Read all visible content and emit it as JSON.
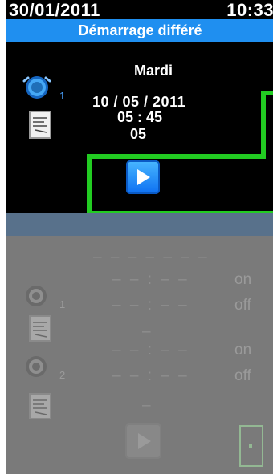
{
  "header": {
    "date": "30/01/2011",
    "time": "10:33",
    "title": "Démarrage différé"
  },
  "schedule": {
    "day": "Mardi",
    "date": "10 / 05 / 2011",
    "time": "05 : 45",
    "extra": "05",
    "alarm_label": "1"
  },
  "lower": {
    "placeholder_top": "– – – – – – –",
    "row1": {
      "label": "1",
      "time1": "– – : – –",
      "time2": "– – : – –",
      "state1": "on",
      "state2": "off"
    },
    "mid_dash": "–",
    "row2": {
      "label": "2",
      "time1": "– – : – –",
      "time2": "– – : – –",
      "state1": "on",
      "state2": "off"
    },
    "bottom_dash": "–"
  },
  "colors": {
    "titlebar": "#1f8ff0",
    "highlight": "#22cc22",
    "panel": "#000000",
    "lower": "#7a7a7a"
  },
  "icons": {
    "alarm": "alarm-clock-icon",
    "doc": "document-icon",
    "play": "play-icon",
    "door": "exit-door-icon"
  }
}
